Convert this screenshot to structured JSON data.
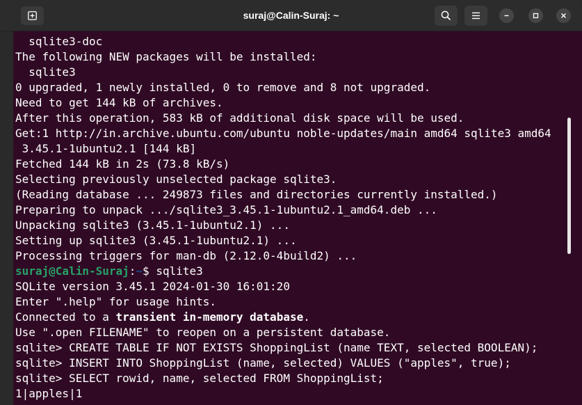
{
  "window": {
    "title": "suraj@Calin-Suraj: ~"
  },
  "terminal": {
    "lines": [
      "  sqlite3-doc",
      "The following NEW packages will be installed:",
      "  sqlite3",
      "0 upgraded, 1 newly installed, 0 to remove and 8 not upgraded.",
      "Need to get 144 kB of archives.",
      "After this operation, 583 kB of additional disk space will be used.",
      "Get:1 http://in.archive.ubuntu.com/ubuntu noble-updates/main amd64 sqlite3 amd64",
      " 3.45.1-1ubuntu2.1 [144 kB]",
      "Fetched 144 kB in 2s (73.8 kB/s)",
      "Selecting previously unselected package sqlite3.",
      "(Reading database ... 249873 files and directories currently installed.)",
      "Preparing to unpack .../sqlite3_3.45.1-1ubuntu2.1_amd64.deb ...",
      "Unpacking sqlite3 (3.45.1-1ubuntu2.1) ...",
      "Setting up sqlite3 (3.45.1-1ubuntu2.1) ...",
      "Processing triggers for man-db (2.12.0-4build2) ..."
    ],
    "prompt_user": "suraj@Calin-Suraj",
    "prompt_sep": ":",
    "prompt_path": "~",
    "prompt_symbol": "$ ",
    "prompt_command": "sqlite3",
    "sqlite_version": "SQLite version 3.45.1 2024-01-30 16:01:20",
    "help_hint": "Enter \".help\" for usage hints.",
    "connected_pre": "Connected to a ",
    "connected_bold": "transient in-memory database",
    "connected_post": ".",
    "open_hint": "Use \".open FILENAME\" to reopen on a persistent database.",
    "sql_lines": [
      "sqlite> CREATE TABLE IF NOT EXISTS ShoppingList (name TEXT, selected BOOLEAN);",
      "sqlite> INSERT INTO ShoppingList (name, selected) VALUES (\"apples\", true);",
      "sqlite> SELECT rowid, name, selected FROM ShoppingList;"
    ],
    "result_line": "1|apples|1"
  }
}
